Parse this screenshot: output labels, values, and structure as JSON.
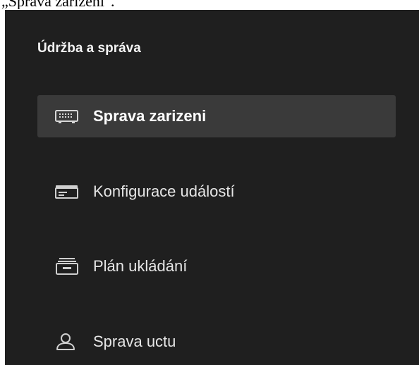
{
  "caption": "„Sprava zarizeni\".",
  "section": {
    "title": "Údržba a správa"
  },
  "nav": {
    "items": [
      {
        "label": "Sprava zarizeni",
        "icon": "device-management-icon",
        "active": true
      },
      {
        "label": "Konfigurace událostí",
        "icon": "event-configuration-icon",
        "active": false
      },
      {
        "label": "Plán ukládání",
        "icon": "storage-schedule-icon",
        "active": false
      },
      {
        "label": "Sprava uctu",
        "icon": "user-account-icon",
        "active": false
      }
    ]
  },
  "colors": {
    "panel_background": "#1f1f1f",
    "active_item_background": "#3a3a3a",
    "text": "#e6e6e6"
  }
}
